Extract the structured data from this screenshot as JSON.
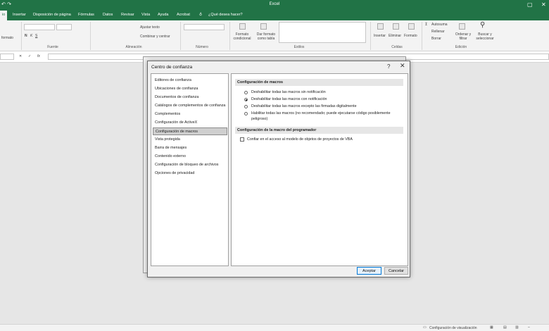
{
  "window": {
    "title": "Excel",
    "qat_glyph": "↶ ↷",
    "close_glyph": "✕"
  },
  "ribbon_tabs": {
    "home": "io",
    "insert": "Insertar",
    "layout": "Disposición de página",
    "formulas": "Fórmulas",
    "data": "Datos",
    "review": "Revisar",
    "view": "Vista",
    "help": "Ayuda",
    "acrobat": "Acrobat",
    "tell_me": "¿Qué desea hacer?"
  },
  "ribbon": {
    "groups": {
      "font": "Fuente",
      "alignment": "Alineación",
      "number": "Número",
      "styles": "Estilos",
      "cells": "Celdas",
      "editing": "Edición"
    },
    "commands": {
      "wrap_text": "Ajustar texto",
      "merge_center": "Combinar y centrar",
      "cond_format": "Formato condicional",
      "format_table": "Dar formato como tabla",
      "insert": "Insertar",
      "delete": "Eliminar",
      "format": "Formato",
      "autosum": "Autosuma",
      "fill": "Rellenar",
      "clear": "Borrar",
      "sort_filter": "Ordenar y filtrar",
      "find_select": "Buscar y seleccionar",
      "clipboard_fragment": "formato",
      "bold": "N",
      "italic": "K",
      "underline": "S"
    }
  },
  "formula_bar": {
    "cancel_glyph": "✕",
    "enter_glyph": "✓",
    "fx": "fx"
  },
  "statusbar": {
    "display_settings": "Configuración de visualización",
    "zoom_minus": "–"
  },
  "dialog": {
    "title": "Centro de confianza",
    "help_glyph": "?",
    "close_glyph": "✕",
    "nav_items": [
      "Editores de confianza",
      "Ubicaciones de confianza",
      "Documentos de confianza",
      "Catálogos de complementos de confianza",
      "Complementos",
      "Configuración de ActiveX",
      "Configuración de macros",
      "Vista protegida",
      "Barra de mensajes",
      "Contenido externo",
      "Configuración de bloqueo de archivos",
      "Opciones de privacidad"
    ],
    "selected_nav_index": 6,
    "macro_section": {
      "header": "Configuración de macros",
      "options": [
        {
          "label": "Deshabilitar todas las macros sin notificación",
          "selected": false
        },
        {
          "label": "Deshabilitar todas las macros con notificación",
          "selected": true
        },
        {
          "label": "Deshabilitar todas las macros excepto las firmadas digitalmente",
          "selected": false
        },
        {
          "label": "Habilitar todas las macros (no recomendado; puede ejecutarse código posiblemente peligroso)",
          "selected": false
        }
      ]
    },
    "developer_section": {
      "header": "Configuración de la macro del programador",
      "checkbox_label": "Confiar en el acceso al modelo de objetos de proyectos de VBA",
      "checked": false
    },
    "buttons": {
      "ok": "Aceptar",
      "cancel": "Cancelar"
    }
  }
}
